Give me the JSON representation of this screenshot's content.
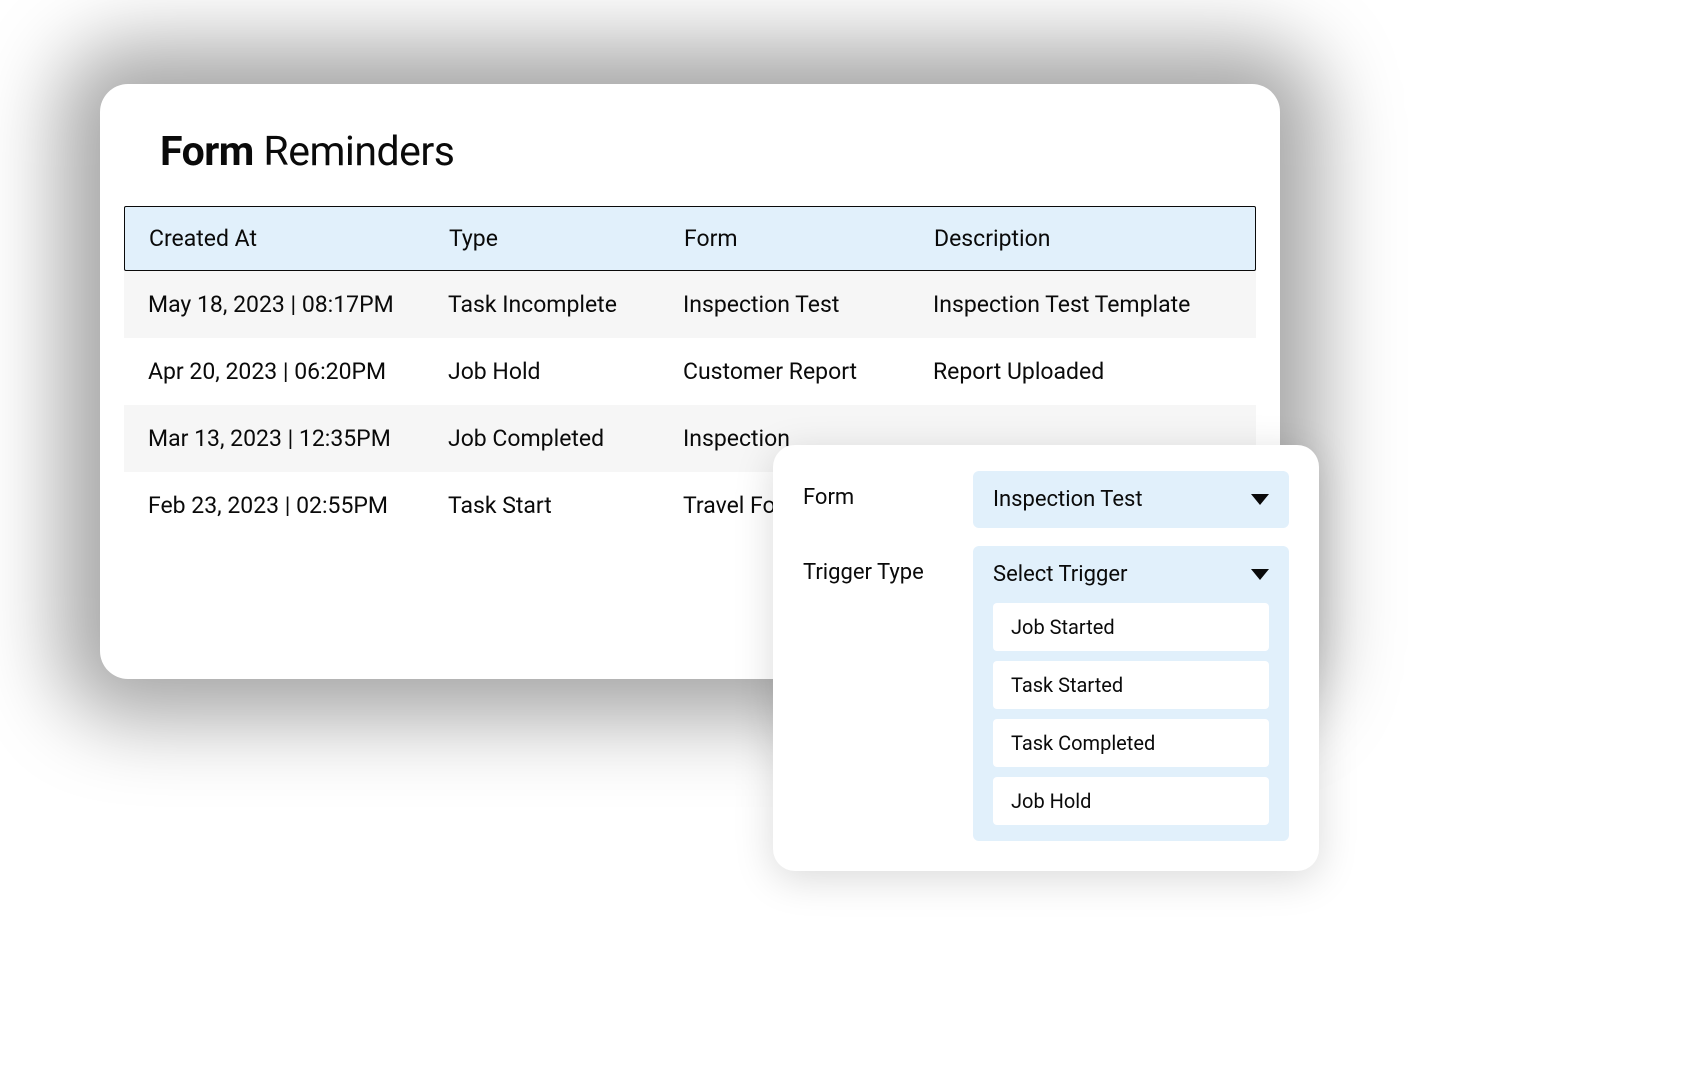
{
  "title": {
    "bold": "Form",
    "light": " Reminders"
  },
  "table": {
    "headers": {
      "created_at": "Created At",
      "type": "Type",
      "form": "Form",
      "description": "Description"
    },
    "rows": [
      {
        "created_at": "May 18, 2023 | 08:17PM",
        "type": "Task Incomplete",
        "form": "Inspection Test",
        "description": "Inspection Test Template"
      },
      {
        "created_at": "Apr 20, 2023 | 06:20PM",
        "type": "Job Hold",
        "form": "Customer Report",
        "description": "Report Uploaded"
      },
      {
        "created_at": "Mar 13, 2023 | 12:35PM",
        "type": "Job Completed",
        "form": "Inspection",
        "description": ""
      },
      {
        "created_at": "Feb 23, 2023 | 02:55PM",
        "type": "Task Start",
        "form": "Travel Fo",
        "description": ""
      }
    ]
  },
  "popup": {
    "form_label": "Form",
    "form_value": "Inspection Test",
    "trigger_label": "Trigger Type",
    "trigger_placeholder": "Select Trigger",
    "trigger_options": [
      "Job Started",
      "Task Started",
      "Task Completed",
      "Job Hold"
    ]
  }
}
